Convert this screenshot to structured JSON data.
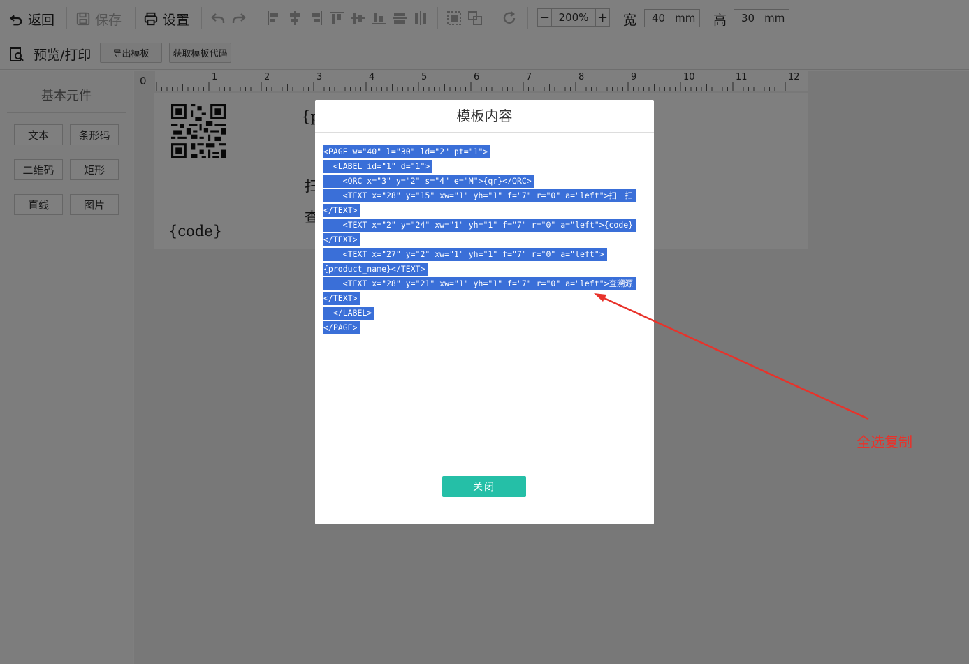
{
  "toolbar": {
    "back_label": "返回",
    "save_label": "保存",
    "settings_label": "设置",
    "zoom_value": "200%",
    "zoom_minus": "−",
    "zoom_plus": "+",
    "width_label": "宽",
    "width_value": "40",
    "width_unit": "mm",
    "height_label": "高",
    "height_value": "30",
    "height_unit": "mm",
    "preview_label": "预览/打印",
    "export_template_label": "导出模板",
    "get_template_code_label": "获取模板代码"
  },
  "left_panel": {
    "title": "基本元件",
    "components": [
      "文本",
      "条形码",
      "二维码",
      "矩形",
      "直线",
      "图片"
    ]
  },
  "ruler": {
    "zero": "0",
    "ticks": [
      "1",
      "2",
      "3",
      "4",
      "5",
      "6",
      "7",
      "8",
      "9",
      "10",
      "11",
      "12"
    ]
  },
  "label_canvas": {
    "product_name": "{product_name}",
    "scan_text": "扫一扫",
    "trace_text": "查溯源",
    "code_text": "{code}",
    "product_name_visible": "{p",
    "scan_visible": "扫",
    "trace_visible": "查"
  },
  "modal": {
    "title": "模板内容",
    "code_lines": [
      "<PAGE w=\"40\" l=\"30\" ld=\"2\" pt=\"1\">",
      "  <LABEL id=\"1\" d=\"1\">",
      "    <QRC x=\"3\" y=\"2\" s=\"4\" e=\"M\">{qr}</QRC>",
      "    <TEXT x=\"28\" y=\"15\" xw=\"1\" yh=\"1\" f=\"7\" r=\"0\" a=\"left\">扫一扫",
      "</TEXT>",
      "    <TEXT x=\"2\" y=\"24\" xw=\"1\" yh=\"1\" f=\"7\" r=\"0\" a=\"left\">{code}",
      "</TEXT>",
      "    <TEXT x=\"27\" y=\"2\" xw=\"1\" yh=\"1\" f=\"7\" r=\"0\" a=\"left\">",
      "{product_name}</TEXT>",
      "    <TEXT x=\"28\" y=\"21\" xw=\"1\" yh=\"1\" f=\"7\" r=\"0\" a=\"left\">查溯源",
      "</TEXT>",
      "  </LABEL>",
      "</PAGE>"
    ],
    "close_label": "关闭"
  },
  "annotation": {
    "text": "全选复制",
    "color": "#e8322a"
  },
  "colors": {
    "selection": "#3a6fd8",
    "close_button": "#25bfa7"
  }
}
